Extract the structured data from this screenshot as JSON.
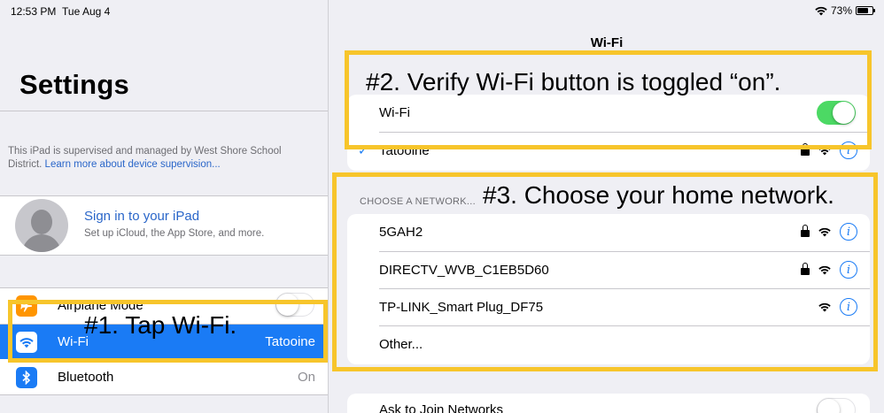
{
  "status_bar": {
    "time": "12:53 PM",
    "date": "Tue Aug 4",
    "battery": "73%",
    "battery_level": 0.73
  },
  "sidebar": {
    "title": "Settings",
    "supervision_text": "This iPad is supervised and managed by West Shore School District.",
    "supervision_link": "Learn more about device supervision...",
    "profile": {
      "title": "Sign in to your iPad",
      "subtitle": "Set up iCloud, the App Store, and more."
    },
    "items": [
      {
        "label": "Airplane Mode",
        "icon": "airplane-icon",
        "toggle": false
      },
      {
        "label": "Wi-Fi",
        "icon": "wifi-icon",
        "value": "Tatooine",
        "selected": true
      },
      {
        "label": "Bluetooth",
        "icon": "bluetooth-icon",
        "value": "On"
      }
    ]
  },
  "detail": {
    "title": "Wi-Fi",
    "wifi_row_label": "Wi-Fi",
    "wifi_on": true,
    "connected_network": "Tatooine",
    "section_label": "CHOOSE A NETWORK...",
    "networks": [
      {
        "name": "5GAH2",
        "locked": true
      },
      {
        "name": "DIRECTV_WVB_C1EB5D60",
        "locked": true
      },
      {
        "name": "TP-LINK_Smart Plug_DF75",
        "locked": false
      }
    ],
    "other_label": "Other...",
    "ask_to_join_label": "Ask to Join Networks"
  },
  "annotations": {
    "step1": "#1. Tap Wi-Fi.",
    "step2": "#2. Verify Wi-Fi button is toggled “on”.",
    "step3": "#3. Choose your home network."
  },
  "colors": {
    "accent_blue": "#1a7bf5",
    "toggle_green": "#4cd964",
    "annotation_yellow": "#f7c52b",
    "airplane_orange": "#ff9500"
  }
}
